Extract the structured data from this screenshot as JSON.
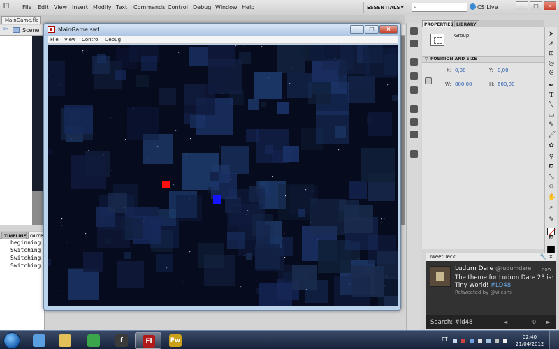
{
  "app": {
    "logo": "Fl",
    "menu": [
      "File",
      "Edit",
      "View",
      "Insert",
      "Modify",
      "Text",
      "Commands",
      "Control",
      "Debug",
      "Window",
      "Help"
    ],
    "workspace": "ESSENTIALS",
    "cs_live": "CS Live",
    "window_buttons": [
      "–",
      "□",
      "×"
    ]
  },
  "document": {
    "tab": "MainGame.fla",
    "scene": "Scene"
  },
  "swf_window": {
    "title": "MainGame.swf",
    "menu": [
      "File",
      "View",
      "Control",
      "Debug"
    ],
    "buttons": [
      "–",
      "□",
      "×"
    ]
  },
  "game": {
    "background": "#070b1e",
    "player_red": "#ff1010",
    "player_blue": "#1414ff"
  },
  "bottom_panel": {
    "tabs": [
      "TIMELINE",
      "OUTPUT"
    ],
    "output_lines": [
      "beginning",
      "Switching",
      "Switching",
      "Switching"
    ]
  },
  "properties": {
    "tabs": [
      "PROPERTIES",
      "LIBRARY"
    ],
    "type": "Group",
    "section": "POSITION AND SIZE",
    "x_label": "X:",
    "x_value": "0,00",
    "y_label": "Y:",
    "y_value": "0,00",
    "w_label": "W:",
    "w_value": "800,00",
    "h_label": "H:",
    "h_value": "600,00"
  },
  "tweetdeck": {
    "title": "TweetDeck",
    "name": "Ludum Dare",
    "handle": "@ludumdare",
    "time": "now",
    "text": "The theme for Ludum Dare 23 is: Tiny World!",
    "hashtag": "#LD48",
    "retweet": "Retweeted by @vilcans",
    "search": "Search: #ld48",
    "prev": "◄",
    "count": "0",
    "next": "►",
    "wrench": "🔧",
    "close": "×"
  },
  "taskbar": {
    "language": "PT",
    "time": "02:40",
    "date": "21/04/2012",
    "apps": [
      {
        "icon": "people-icon",
        "glyph": "",
        "color": "#5aa0e0"
      },
      {
        "icon": "folder-icon",
        "glyph": "",
        "color": "#e4c05a"
      },
      {
        "icon": "chrome-icon",
        "glyph": "",
        "color": "#3aa54a"
      },
      {
        "icon": "fdt-icon",
        "glyph": "f",
        "color": "#3a3a3a"
      },
      {
        "icon": "flash-icon",
        "glyph": "Fl",
        "color": "#b11a1a"
      },
      {
        "icon": "fireworks-icon",
        "glyph": "Fw",
        "color": "#c9a21a"
      }
    ]
  }
}
